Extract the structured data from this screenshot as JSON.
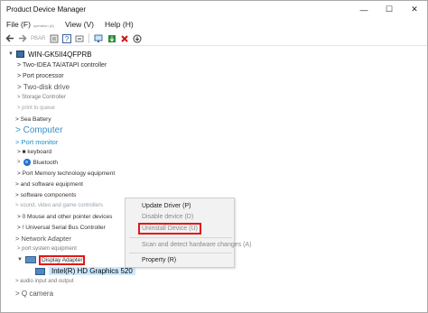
{
  "window": {
    "title": "Product Device Manager"
  },
  "window_controls": {
    "minimize": "—",
    "maximize": "☐",
    "close": "✕"
  },
  "menubar": [
    {
      "label": "File (F)",
      "sub": ""
    },
    {
      "label": "View (V)",
      "sub": ""
    },
    {
      "label": "Help (H)",
      "sub": ""
    }
  ],
  "menubar_small": "operation (A)",
  "toolbar": {
    "faint_label": "PBAR"
  },
  "tree": {
    "root": "WIN-GK5II4QFPRB",
    "items": [
      "Two-IDEA TA/ATAPI controller",
      "Port processor",
      "Two-disk drive",
      "Storage Controller",
      "print to queue",
      "Sea Battery",
      "Computer",
      "Port monitor",
      "keyboard",
      "Bluetooth",
      "Port Memory technology equipment",
      "and software equipment",
      "software components",
      "sound, video and game controllers",
      "Mouse and other pointer devices",
      "Universal Serial Bus Controller",
      "Network Adapter",
      "port system equipment",
      "Display Adapter",
      "Intel(R) HD Graphics 520",
      "audio input and output",
      "Q camera"
    ],
    "prefix_items": {
      "mouse": "0",
      "usb": "!",
      "keyboard": "■"
    }
  },
  "context_menu": {
    "update_driver": "Update Driver (P)",
    "disable_device": "Disable device (D)",
    "uninstall_device": "Uninstall Device (U)",
    "scan_hardware": "Scan and detect hardware changes (A)",
    "property": "Property (R)"
  }
}
